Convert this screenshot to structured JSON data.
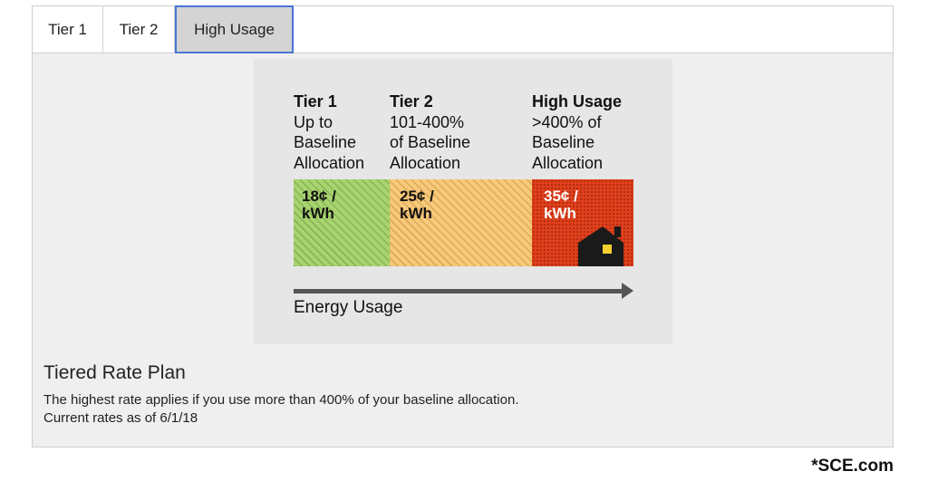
{
  "tabs": [
    {
      "label": "Tier 1",
      "selected": false
    },
    {
      "label": "Tier 2",
      "selected": false
    },
    {
      "label": "High Usage",
      "selected": true
    }
  ],
  "graphic": {
    "columns": [
      {
        "title": "Tier 1",
        "lines": [
          "Up to",
          "Baseline",
          "Allocation"
        ],
        "rate": "18¢ /",
        "rate_unit": "kWh",
        "color": "#a7d46f"
      },
      {
        "title": "Tier 2",
        "lines": [
          "101-400%",
          "of Baseline",
          "Allocation"
        ],
        "rate": "25¢ /",
        "rate_unit": "kWh",
        "color": "#f7c97a"
      },
      {
        "title": "High Usage",
        "lines": [
          ">400% of",
          "Baseline",
          "Allocation"
        ],
        "rate": "35¢ /",
        "rate_unit": "kWh",
        "color": "#e0401c"
      }
    ],
    "axis_label": "Energy Usage",
    "icon": "house-icon"
  },
  "plan": {
    "title": "Tiered Rate Plan",
    "description": "The highest rate applies if you use more than 400% of your baseline allocation.",
    "rates_date": "Current rates as of 6/1/18"
  },
  "source": "*SCE.com",
  "colors": {
    "accent": "#4a74d6",
    "selected_tab_bg": "#d4d4d4",
    "panel_bg": "#efefef"
  }
}
